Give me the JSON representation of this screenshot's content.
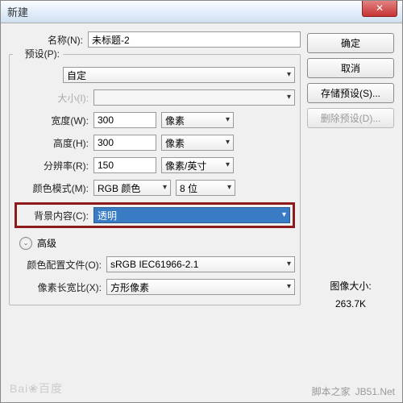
{
  "title": "新建",
  "labels": {
    "name": "名称(N):",
    "preset": "预设(P):",
    "size": "大小(I):",
    "width": "宽度(W):",
    "height": "高度(H):",
    "resolution": "分辨率(R):",
    "colorMode": "颜色模式(M):",
    "bgContent": "背景内容(C):",
    "advanced": "高级",
    "colorProfile": "颜色配置文件(O):",
    "pixelAspect": "像素长宽比(X):"
  },
  "values": {
    "name": "未标题-2",
    "preset": "自定",
    "width": "300",
    "height": "300",
    "resolution": "150",
    "widthUnit": "像素",
    "heightUnit": "像素",
    "resUnit": "像素/英寸",
    "colorMode": "RGB 颜色",
    "bits": "8 位",
    "bgContent": "透明",
    "colorProfile": "sRGB IEC61966-2.1",
    "pixelAspect": "方形像素"
  },
  "buttons": {
    "ok": "确定",
    "cancel": "取消",
    "savePreset": "存储预设(S)...",
    "deletePreset": "删除预设(D)..."
  },
  "info": {
    "imageSizeLabel": "图像大小:",
    "imageSize": "263.7K"
  },
  "watermark": {
    "site": "脚本之家",
    "url": "JB51.Net",
    "baidu": "Bai❀百度"
  }
}
